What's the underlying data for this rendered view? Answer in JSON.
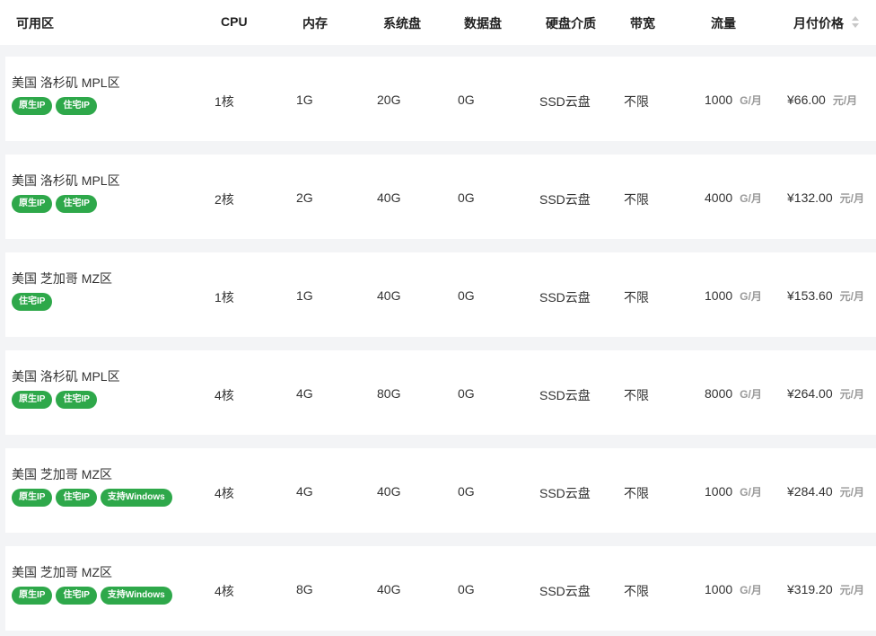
{
  "header": {
    "zone": "可用区",
    "cpu": "CPU",
    "memory": "内存",
    "system_disk": "系统盘",
    "data_disk": "数据盘",
    "disk_media": "硬盘介质",
    "bandwidth": "带宽",
    "traffic": "流量",
    "price": "月付价格"
  },
  "colors": {
    "tag_bg": "#2ea84a",
    "row_bg": "#ffffff",
    "page_bg": "#f3f4f6"
  },
  "rows": [
    {
      "zone": "美国 洛杉矶 MPL区",
      "tags": [
        "原生IP",
        "住宅IP"
      ],
      "cpu": "1核",
      "memory": "1G",
      "system_disk": "20G",
      "data_disk": "0G",
      "disk_media": "SSD云盘",
      "bandwidth": "不限",
      "traffic": "1000",
      "traffic_unit": "G/月",
      "price": "¥66.00",
      "price_unit": "元/月"
    },
    {
      "zone": "美国 洛杉矶 MPL区",
      "tags": [
        "原生IP",
        "住宅IP"
      ],
      "cpu": "2核",
      "memory": "2G",
      "system_disk": "40G",
      "data_disk": "0G",
      "disk_media": "SSD云盘",
      "bandwidth": "不限",
      "traffic": "4000",
      "traffic_unit": "G/月",
      "price": "¥132.00",
      "price_unit": "元/月"
    },
    {
      "zone": "美国 芝加哥 MZ区",
      "tags": [
        "住宅IP"
      ],
      "cpu": "1核",
      "memory": "1G",
      "system_disk": "40G",
      "data_disk": "0G",
      "disk_media": "SSD云盘",
      "bandwidth": "不限",
      "traffic": "1000",
      "traffic_unit": "G/月",
      "price": "¥153.60",
      "price_unit": "元/月"
    },
    {
      "zone": "美国 洛杉矶 MPL区",
      "tags": [
        "原生IP",
        "住宅IP"
      ],
      "cpu": "4核",
      "memory": "4G",
      "system_disk": "80G",
      "data_disk": "0G",
      "disk_media": "SSD云盘",
      "bandwidth": "不限",
      "traffic": "8000",
      "traffic_unit": "G/月",
      "price": "¥264.00",
      "price_unit": "元/月"
    },
    {
      "zone": "美国 芝加哥 MZ区",
      "tags": [
        "原生IP",
        "住宅IP",
        "支持Windows"
      ],
      "cpu": "4核",
      "memory": "4G",
      "system_disk": "40G",
      "data_disk": "0G",
      "disk_media": "SSD云盘",
      "bandwidth": "不限",
      "traffic": "1000",
      "traffic_unit": "G/月",
      "price": "¥284.40",
      "price_unit": "元/月"
    },
    {
      "zone": "美国 芝加哥 MZ区",
      "tags": [
        "原生IP",
        "住宅IP",
        "支持Windows"
      ],
      "cpu": "4核",
      "memory": "8G",
      "system_disk": "40G",
      "data_disk": "0G",
      "disk_media": "SSD云盘",
      "bandwidth": "不限",
      "traffic": "1000",
      "traffic_unit": "G/月",
      "price": "¥319.20",
      "price_unit": "元/月"
    }
  ]
}
